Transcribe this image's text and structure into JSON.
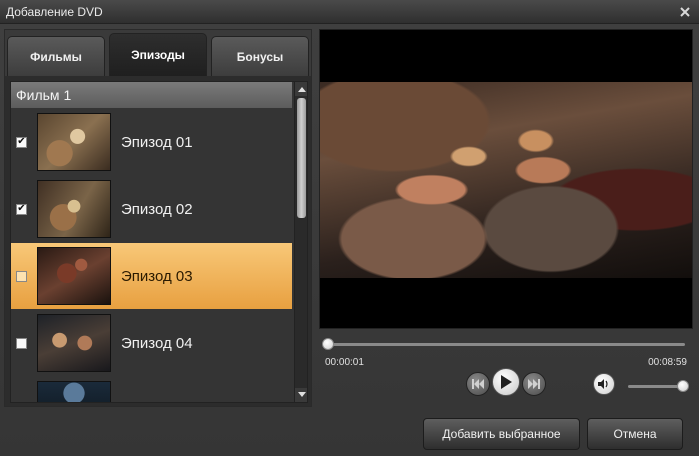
{
  "window": {
    "title": "Добавление DVD"
  },
  "tabs": [
    {
      "label": "Фильмы",
      "active": false
    },
    {
      "label": "Эпизоды",
      "active": true
    },
    {
      "label": "Бонусы",
      "active": false
    }
  ],
  "list": {
    "group_title": "Фильм 1",
    "items": [
      {
        "label": "Эпизод 01",
        "checked": true,
        "selected": false
      },
      {
        "label": "Эпизод 02",
        "checked": true,
        "selected": false
      },
      {
        "label": "Эпизод 03",
        "checked": false,
        "selected": true
      },
      {
        "label": "Эпизод 04",
        "checked": false,
        "selected": false
      }
    ]
  },
  "player": {
    "current_time": "00:00:01",
    "total_time": "00:08:59",
    "progress": 0.002,
    "volume": 1.0
  },
  "footer": {
    "add_label": "Добавить выбранное",
    "cancel_label": "Отмена"
  },
  "colors": {
    "selection": "#f0b050",
    "background": "#3a3a3a"
  }
}
